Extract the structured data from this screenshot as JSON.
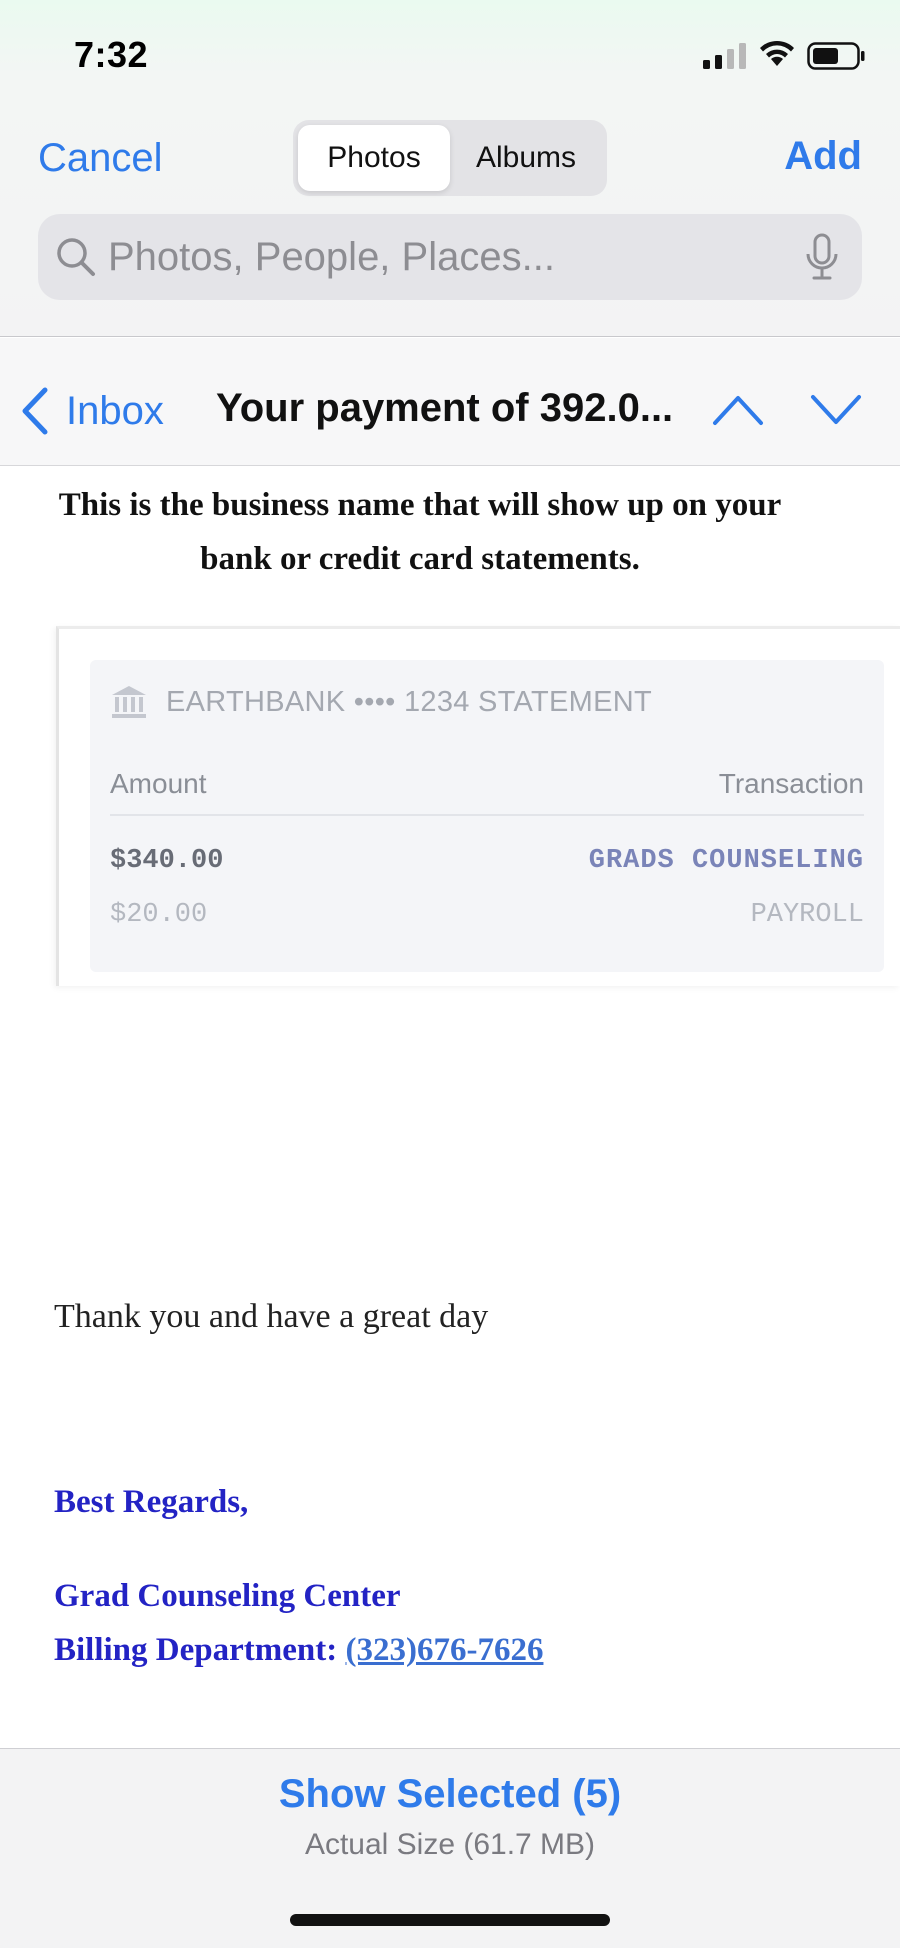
{
  "status_bar": {
    "time": "7:32"
  },
  "picker": {
    "cancel_label": "Cancel",
    "add_label": "Add",
    "tabs": [
      {
        "label": "Photos",
        "active": true
      },
      {
        "label": "Albums",
        "active": false
      }
    ],
    "search": {
      "placeholder": "Photos, People, Places..."
    }
  },
  "mail_nav": {
    "back_label": "Inbox",
    "subject": "Your payment of 392.0..."
  },
  "email": {
    "intro": "This is the business name that will show up on your bank or credit card statements.",
    "statement": {
      "bank_label": "EARTHBANK •••• 1234 STATEMENT",
      "columns": {
        "amount": "Amount",
        "transaction": "Transaction"
      },
      "rows": [
        {
          "amount": "$340.00",
          "transaction": "GRADS COUNSELING"
        },
        {
          "amount": "$20.00",
          "transaction": "PAYROLL"
        }
      ]
    },
    "thanks": "Thank you and have a great day",
    "regards": "Best Regards,",
    "company": "Grad Counseling Center",
    "billing_label": "Billing Department:",
    "phone": "(323)676-7626"
  },
  "footer": {
    "show_selected": "Show Selected (5)",
    "actual_size": "Actual Size (61.7 MB)"
  },
  "colors": {
    "accent": "#2f7bea",
    "signature": "#2323c4",
    "link": "#3a6ed0"
  }
}
